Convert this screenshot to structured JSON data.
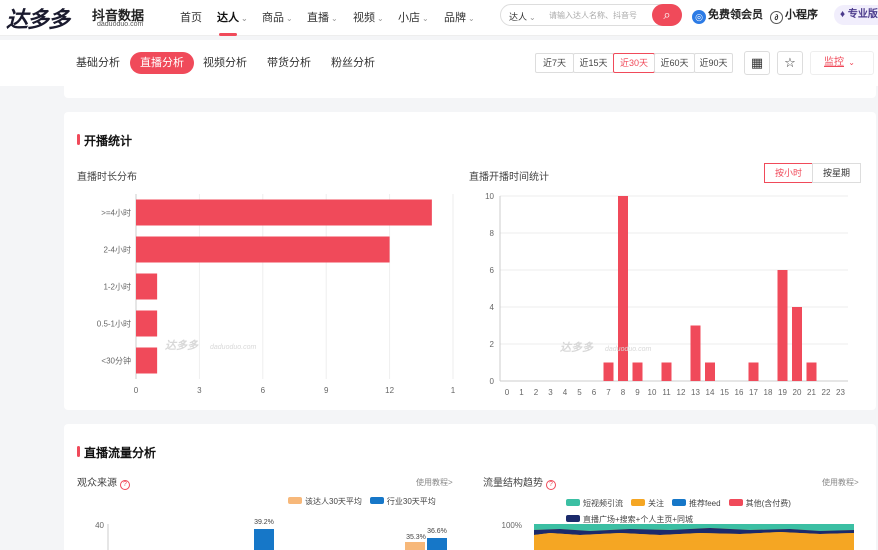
{
  "brand": {
    "logo_text": "达多多",
    "sub": "抖音数据",
    "url": "daduoduo.com"
  },
  "nav": [
    {
      "label": "首页",
      "caret": false
    },
    {
      "label": "达人",
      "caret": true
    },
    {
      "label": "商品",
      "caret": true
    },
    {
      "label": "直播",
      "caret": true
    },
    {
      "label": "视频",
      "caret": true
    },
    {
      "label": "小店",
      "caret": true
    },
    {
      "label": "品牌",
      "caret": true
    }
  ],
  "search": {
    "type": "达人",
    "placeholder": "请输入达人名称、抖音号"
  },
  "header_actions": {
    "vip": "免费领会员",
    "mini": "小程序",
    "pro": "专业版"
  },
  "tabs": [
    "基础分析",
    "直播分析",
    "视频分析",
    "带货分析",
    "粉丝分析"
  ],
  "ranges": [
    "近7天",
    "近15天",
    "近30天",
    "近60天",
    "近90天"
  ],
  "monitor_label": "监控",
  "section1": {
    "title": "开播统计",
    "left_title": "直播时长分布",
    "right_title": "直播开播时间统计",
    "toggles": [
      "按小时",
      "按星期"
    ]
  },
  "section2": {
    "title": "直播流量分析",
    "left_title": "观众来源",
    "right_title": "流量结构趋势",
    "help": "使用教程>",
    "legend_left": [
      "该达人30天平均",
      "行业30天平均"
    ],
    "legend_right": [
      "短视频引流",
      "关注",
      "推荐feed",
      "其他(含付费)",
      "直播广场+搜索+个人主页+同城"
    ],
    "left_axis_top": "40",
    "left_labels": [
      "39.2%",
      "35.3%",
      "36.6%"
    ],
    "right_axis_top": "100%"
  },
  "watermark": {
    "text": "达多多",
    "url": "daduoduo.com"
  },
  "colors": {
    "accent": "#f04a5a",
    "bar": "#f04a5a",
    "orange": "#f5a623",
    "blue": "#1677c8",
    "teal": "#3bbfa3",
    "navy": "#1b2a6b",
    "light_orange": "#f7b87a"
  },
  "chart_data": [
    {
      "type": "bar",
      "orientation": "horizontal",
      "categories": [
        ">=4小时",
        "2-4小时",
        "1-2小时",
        "0.5-1小时",
        "<30分钟"
      ],
      "values": [
        14,
        12,
        1,
        1,
        1
      ],
      "xlim": [
        0,
        15
      ],
      "xticks": [
        "0",
        "3",
        "6",
        "9",
        "12",
        "1"
      ],
      "grid": true
    },
    {
      "type": "bar",
      "categories": [
        "0",
        "1",
        "2",
        "3",
        "4",
        "5",
        "6",
        "7",
        "8",
        "9",
        "10",
        "11",
        "12",
        "13",
        "14",
        "15",
        "16",
        "17",
        "18",
        "19",
        "20",
        "21",
        "22",
        "23"
      ],
      "values": [
        0,
        0,
        0,
        0,
        0,
        0,
        0,
        1,
        10,
        1,
        0,
        1,
        0,
        3,
        1,
        0,
        0,
        1,
        0,
        6,
        4,
        1,
        0,
        0
      ],
      "ylim": [
        0,
        10
      ],
      "yticks": [
        "0",
        "2",
        "4",
        "6",
        "8",
        "10"
      ],
      "grid": true
    }
  ]
}
